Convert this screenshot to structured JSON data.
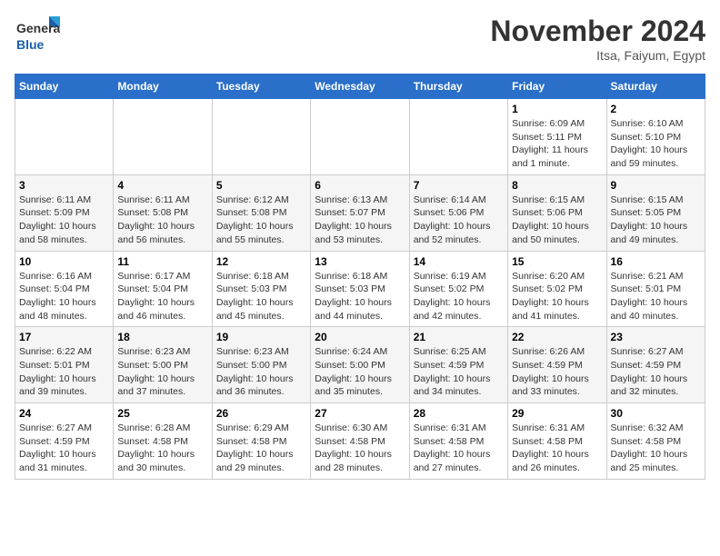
{
  "header": {
    "logo": {
      "line1": "General",
      "line2": "Blue"
    },
    "month": "November 2024",
    "location": "Itsa, Faiyum, Egypt"
  },
  "weekdays": [
    "Sunday",
    "Monday",
    "Tuesday",
    "Wednesday",
    "Thursday",
    "Friday",
    "Saturday"
  ],
  "weeks": [
    [
      {
        "day": "",
        "info": ""
      },
      {
        "day": "",
        "info": ""
      },
      {
        "day": "",
        "info": ""
      },
      {
        "day": "",
        "info": ""
      },
      {
        "day": "",
        "info": ""
      },
      {
        "day": "1",
        "info": "Sunrise: 6:09 AM\nSunset: 5:11 PM\nDaylight: 11 hours and 1 minute."
      },
      {
        "day": "2",
        "info": "Sunrise: 6:10 AM\nSunset: 5:10 PM\nDaylight: 10 hours and 59 minutes."
      }
    ],
    [
      {
        "day": "3",
        "info": "Sunrise: 6:11 AM\nSunset: 5:09 PM\nDaylight: 10 hours and 58 minutes."
      },
      {
        "day": "4",
        "info": "Sunrise: 6:11 AM\nSunset: 5:08 PM\nDaylight: 10 hours and 56 minutes."
      },
      {
        "day": "5",
        "info": "Sunrise: 6:12 AM\nSunset: 5:08 PM\nDaylight: 10 hours and 55 minutes."
      },
      {
        "day": "6",
        "info": "Sunrise: 6:13 AM\nSunset: 5:07 PM\nDaylight: 10 hours and 53 minutes."
      },
      {
        "day": "7",
        "info": "Sunrise: 6:14 AM\nSunset: 5:06 PM\nDaylight: 10 hours and 52 minutes."
      },
      {
        "day": "8",
        "info": "Sunrise: 6:15 AM\nSunset: 5:06 PM\nDaylight: 10 hours and 50 minutes."
      },
      {
        "day": "9",
        "info": "Sunrise: 6:15 AM\nSunset: 5:05 PM\nDaylight: 10 hours and 49 minutes."
      }
    ],
    [
      {
        "day": "10",
        "info": "Sunrise: 6:16 AM\nSunset: 5:04 PM\nDaylight: 10 hours and 48 minutes."
      },
      {
        "day": "11",
        "info": "Sunrise: 6:17 AM\nSunset: 5:04 PM\nDaylight: 10 hours and 46 minutes."
      },
      {
        "day": "12",
        "info": "Sunrise: 6:18 AM\nSunset: 5:03 PM\nDaylight: 10 hours and 45 minutes."
      },
      {
        "day": "13",
        "info": "Sunrise: 6:18 AM\nSunset: 5:03 PM\nDaylight: 10 hours and 44 minutes."
      },
      {
        "day": "14",
        "info": "Sunrise: 6:19 AM\nSunset: 5:02 PM\nDaylight: 10 hours and 42 minutes."
      },
      {
        "day": "15",
        "info": "Sunrise: 6:20 AM\nSunset: 5:02 PM\nDaylight: 10 hours and 41 minutes."
      },
      {
        "day": "16",
        "info": "Sunrise: 6:21 AM\nSunset: 5:01 PM\nDaylight: 10 hours and 40 minutes."
      }
    ],
    [
      {
        "day": "17",
        "info": "Sunrise: 6:22 AM\nSunset: 5:01 PM\nDaylight: 10 hours and 39 minutes."
      },
      {
        "day": "18",
        "info": "Sunrise: 6:23 AM\nSunset: 5:00 PM\nDaylight: 10 hours and 37 minutes."
      },
      {
        "day": "19",
        "info": "Sunrise: 6:23 AM\nSunset: 5:00 PM\nDaylight: 10 hours and 36 minutes."
      },
      {
        "day": "20",
        "info": "Sunrise: 6:24 AM\nSunset: 5:00 PM\nDaylight: 10 hours and 35 minutes."
      },
      {
        "day": "21",
        "info": "Sunrise: 6:25 AM\nSunset: 4:59 PM\nDaylight: 10 hours and 34 minutes."
      },
      {
        "day": "22",
        "info": "Sunrise: 6:26 AM\nSunset: 4:59 PM\nDaylight: 10 hours and 33 minutes."
      },
      {
        "day": "23",
        "info": "Sunrise: 6:27 AM\nSunset: 4:59 PM\nDaylight: 10 hours and 32 minutes."
      }
    ],
    [
      {
        "day": "24",
        "info": "Sunrise: 6:27 AM\nSunset: 4:59 PM\nDaylight: 10 hours and 31 minutes."
      },
      {
        "day": "25",
        "info": "Sunrise: 6:28 AM\nSunset: 4:58 PM\nDaylight: 10 hours and 30 minutes."
      },
      {
        "day": "26",
        "info": "Sunrise: 6:29 AM\nSunset: 4:58 PM\nDaylight: 10 hours and 29 minutes."
      },
      {
        "day": "27",
        "info": "Sunrise: 6:30 AM\nSunset: 4:58 PM\nDaylight: 10 hours and 28 minutes."
      },
      {
        "day": "28",
        "info": "Sunrise: 6:31 AM\nSunset: 4:58 PM\nDaylight: 10 hours and 27 minutes."
      },
      {
        "day": "29",
        "info": "Sunrise: 6:31 AM\nSunset: 4:58 PM\nDaylight: 10 hours and 26 minutes."
      },
      {
        "day": "30",
        "info": "Sunrise: 6:32 AM\nSunset: 4:58 PM\nDaylight: 10 hours and 25 minutes."
      }
    ]
  ]
}
